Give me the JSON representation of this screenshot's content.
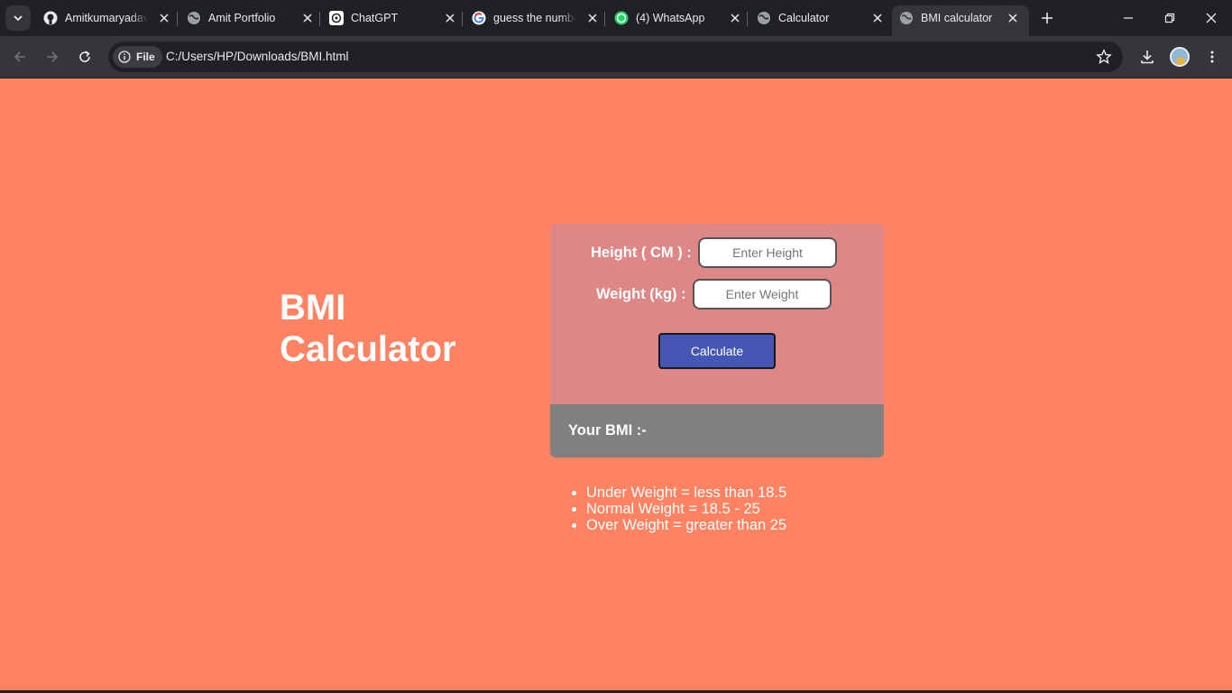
{
  "browser": {
    "tabs": [
      {
        "title": "Amitkumaryadav",
        "icon": "github-icon",
        "active": false
      },
      {
        "title": "Amit Portfolio",
        "icon": "globe-icon",
        "active": false
      },
      {
        "title": "ChatGPT",
        "icon": "chatgpt-icon",
        "active": false
      },
      {
        "title": "guess the numbe",
        "icon": "google-icon",
        "active": false
      },
      {
        "title": "(4) WhatsApp",
        "icon": "whatsapp-icon",
        "active": false
      },
      {
        "title": "Calculator",
        "icon": "globe-icon",
        "active": false
      },
      {
        "title": "BMI calculator",
        "icon": "globe-icon",
        "active": true
      }
    ],
    "address": {
      "chip_label": "File",
      "url": "C:/Users/HP/Downloads/BMI.html"
    }
  },
  "page": {
    "title_line1": "BMI",
    "title_line2": "Calculator",
    "form": {
      "height_label": "Height ( CM ) :",
      "height_placeholder": "Enter Height",
      "weight_label": "Weight (kg) :",
      "weight_placeholder": "Enter Weight",
      "button_label": "Calculate"
    },
    "result_label": "Your BMI :-",
    "ranges": [
      "Under Weight = less than 18.5",
      "Normal Weight = 18.5 - 25",
      "Over Weight = greater than 25"
    ]
  },
  "colors": {
    "page_background": "#ff8363",
    "card_background": "#de8787",
    "result_background": "#808080",
    "button_background": "#4556b5"
  }
}
